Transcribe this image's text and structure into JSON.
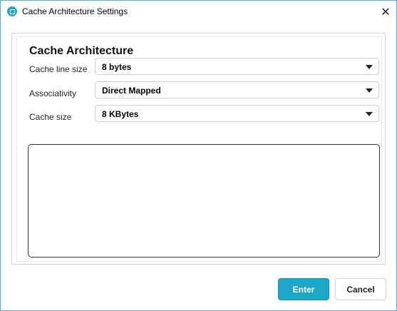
{
  "window": {
    "title": "Cache Architecture Settings",
    "accent_color": "#1ba9c7",
    "border_color": "#58a9e8"
  },
  "titlebar": {
    "app_icon": "cache-icon",
    "close_icon": "close-icon",
    "close_glyph": "✕"
  },
  "form": {
    "section_title": "Cache Architecture",
    "fields": [
      {
        "label": "Cache line size",
        "value": "8 bytes"
      },
      {
        "label": "Associativity",
        "value": "Direct Mapped"
      },
      {
        "label": "Cache size",
        "value": "8 KBytes"
      }
    ],
    "output_text": ""
  },
  "footer": {
    "enter_label": "Enter",
    "cancel_label": "Cancel"
  }
}
